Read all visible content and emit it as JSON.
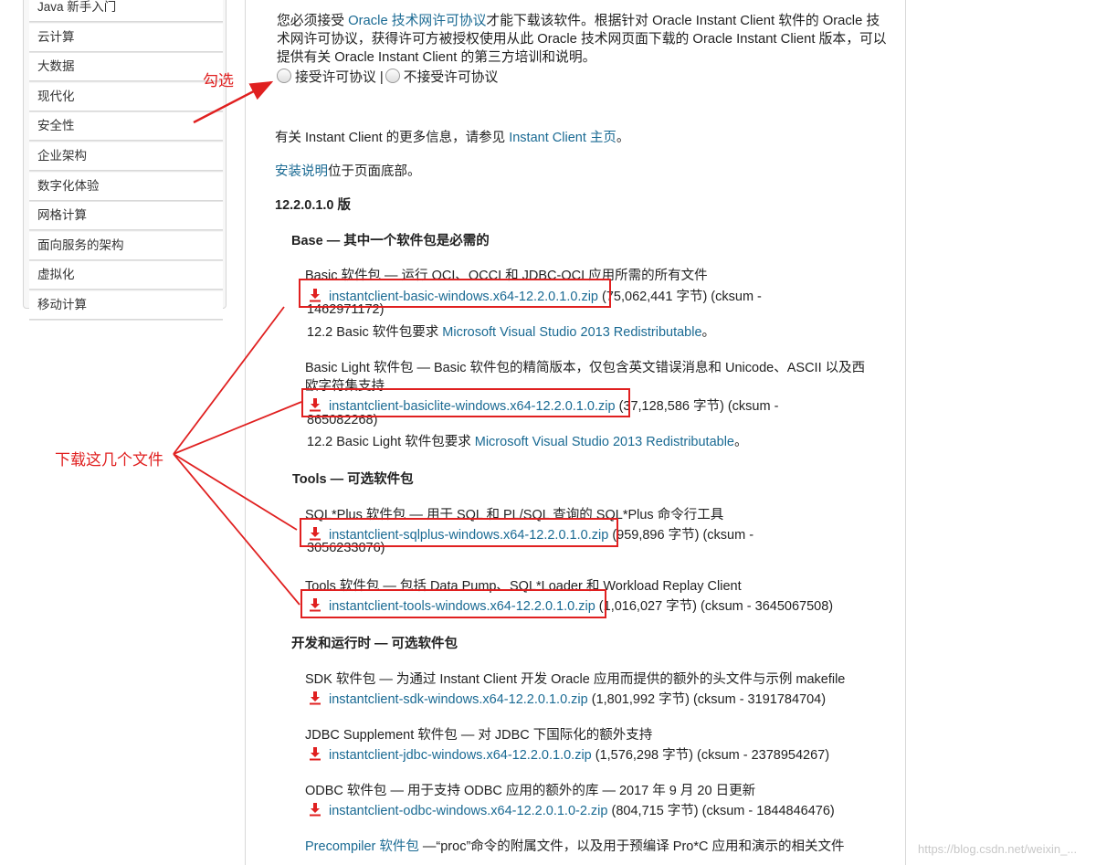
{
  "sidebar": {
    "items": [
      "Java 新手入门",
      "云计算",
      "大数据",
      "现代化",
      "安全性",
      "企业架构",
      "数字化体验",
      "网格计算",
      "面向服务的架构",
      "虚拟化",
      "移动计算"
    ]
  },
  "notice": {
    "pre": "您必须接受 ",
    "license_link": "Oracle 技术网许可协议",
    "post": "才能下载该软件。根据针对 Oracle Instant Client 软件的 Oracle 技术网许可协议，获得许可方被授权使用从此 Oracle 技术网页面下载的 Oracle Instant Client 版本，可以提供有关 Oracle Instant Client 的第三方培训和说明。"
  },
  "radios": {
    "accept": "接受许可协议",
    "separator": "|",
    "decline": "不接受许可协议"
  },
  "info": {
    "more_pre": "有关 Instant Client 的更多信息，请参见 ",
    "more_link": "Instant Client 主页",
    "more_post": "。",
    "install_link": "安装说明",
    "install_post": "位于页面底部。"
  },
  "version": "12.2.0.1.0 版",
  "sections": {
    "base": "Base — 其中一个软件包是必需的",
    "tools": "Tools — 可选软件包",
    "dev": "开发和运行时 — 可选软件包"
  },
  "packages": {
    "basic": {
      "desc": "Basic 软件包 — 运行 OCI、OCCI 和 JDBC-OCI 应用所需的所有文件",
      "file": "instantclient-basic-windows.x64-12.2.0.1.0.zip",
      "meta": "(75,062,441 字节) (cksum -",
      "meta2": "1462971172)",
      "req_pre": "12.2 Basic 软件包要求 ",
      "req_link": "Microsoft Visual Studio 2013 Redistributable",
      "req_post": "。"
    },
    "basiclite": {
      "desc": "Basic Light 软件包 — Basic 软件包的精简版本，仅包含英文错误消息和 Unicode、ASCII 以及西",
      "desc2": "欧字符集支持",
      "file": "instantclient-basiclite-windows.x64-12.2.0.1.0.zip",
      "meta": "(37,128,586 字节) (cksum -",
      "meta2": "865082268)",
      "req_pre": "12.2 Basic Light 软件包要求 ",
      "req_link": "Microsoft Visual Studio 2013 Redistributable",
      "req_post": "。"
    },
    "sqlplus": {
      "desc": "SQL*Plus 软件包 — 用于 SQL 和 PL/SQL 查询的 SQL*Plus 命令行工具",
      "file": "instantclient-sqlplus-windows.x64-12.2.0.1.0.zip",
      "meta": "(959,896 字节) (cksum -",
      "meta2": "3056233076)"
    },
    "tools": {
      "desc": "Tools 软件包 — 包括 Data Pump、SQL*Loader 和 Workload Replay Client",
      "file": "instantclient-tools-windows.x64-12.2.0.1.0.zip",
      "meta": "(1,016,027 字节) (cksum - 3645067508)"
    },
    "sdk": {
      "desc": "SDK 软件包 — 为通过 Instant Client 开发 Oracle 应用而提供的额外的头文件与示例 makefile",
      "file": "instantclient-sdk-windows.x64-12.2.0.1.0.zip",
      "meta": "(1,801,992 字节) (cksum - 3191784704)"
    },
    "jdbc": {
      "desc": "JDBC Supplement 软件包 — 对 JDBC 下国际化的额外支持",
      "file": "instantclient-jdbc-windows.x64-12.2.0.1.0.zip",
      "meta": "(1,576,298 字节) (cksum - 2378954267)"
    },
    "odbc": {
      "desc": "ODBC 软件包 — 用于支持 ODBC 应用的额外的库 — 2017 年 9 月 20 日更新",
      "file": "instantclient-odbc-windows.x64-12.2.0.1.0-2.zip",
      "meta": "(804,715 字节) (cksum - 1844846476)"
    },
    "precompiler": {
      "link": "Precompiler 软件包",
      "desc": " —“proc”命令的附属文件，以及用于预编译 Pro*C 应用和演示的相关文件"
    }
  },
  "annotations": {
    "check": "勾选",
    "download": "下载这几个文件"
  },
  "watermark": "https://blog.csdn.net/weixin_..."
}
